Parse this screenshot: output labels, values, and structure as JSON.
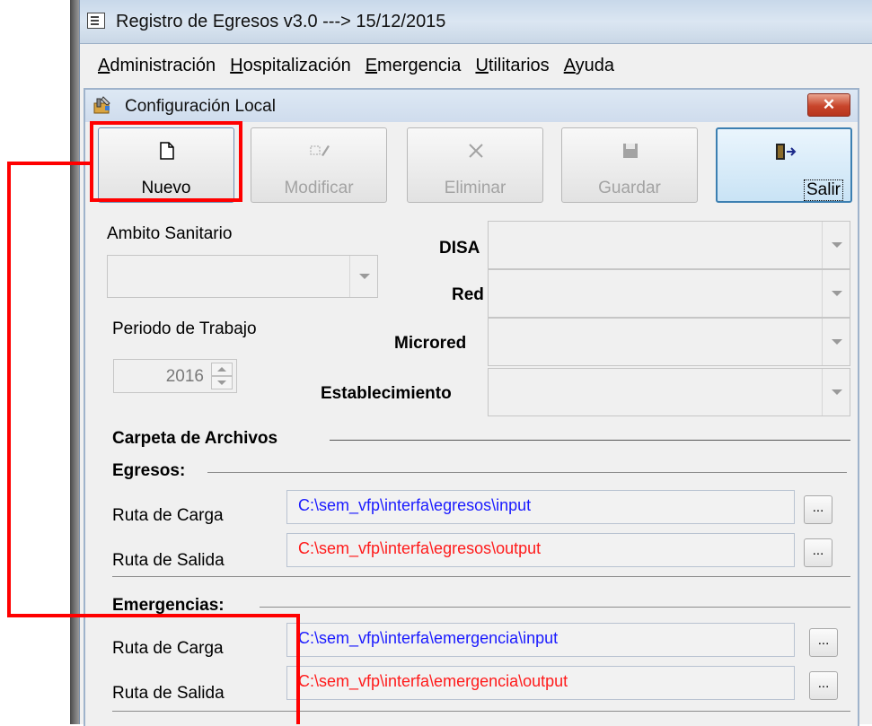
{
  "app": {
    "title": "Registro de Egresos v3.0  ---> 15/12/2015",
    "menu": [
      "Administración",
      "Hospitalización",
      "Emergencia",
      "Utilitarios",
      "Ayuda"
    ]
  },
  "dialog": {
    "title": "Configuración Local",
    "close_label": "✕",
    "toolbar": {
      "nuevo": "Nuevo",
      "modificar": "Modificar",
      "eliminar": "Eliminar",
      "guardar": "Guardar",
      "salir": "Salir"
    },
    "form": {
      "ambito_label": "Ambito Sanitario",
      "ambito_value": "",
      "disa_label": "DISA",
      "red_label": "Red",
      "microred_label": "Microred",
      "establecimiento_label": "Establecimiento",
      "periodo_label": "Periodo de Trabajo",
      "periodo_value": "2016"
    },
    "carpeta": {
      "section_label": "Carpeta de Archivos",
      "egresos_label": "Egresos:",
      "emergencias_label": "Emergencias:",
      "ruta_carga_label": "Ruta de Carga",
      "ruta_salida_label": "Ruta de Salida",
      "egresos_carga": "C:\\sem_vfp\\interfa\\egresos\\input",
      "egresos_salida": "C:\\sem_vfp\\interfa\\egresos\\output",
      "emergencia_carga": "C:\\sem_vfp\\interfa\\emergencia\\input",
      "emergencia_salida": "C:\\sem_vfp\\interfa\\emergencia\\output",
      "browse_label": "..."
    }
  },
  "colors": {
    "highlight": "#ff0000",
    "path_input": "#1a1aff",
    "path_output": "#ff1a1a"
  }
}
